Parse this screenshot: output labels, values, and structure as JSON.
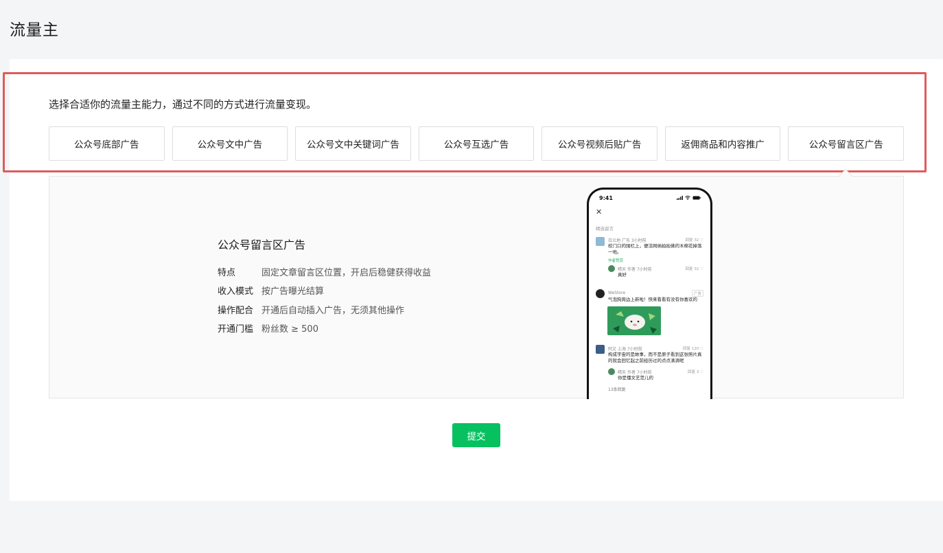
{
  "page": {
    "title": "流量主"
  },
  "intro": {
    "text": "选择合适你的流量主能力，通过不同的方式进行流量变现。"
  },
  "options": [
    {
      "label": "公众号底部广告"
    },
    {
      "label": "公众号文中广告"
    },
    {
      "label": "公众号文中关键词广告"
    },
    {
      "label": "公众号互选广告"
    },
    {
      "label": "公众号视频后贴广告"
    },
    {
      "label": "返佣商品和内容推广"
    },
    {
      "label": "公众号留言区广告"
    }
  ],
  "detail": {
    "title": "公众号留言区广告",
    "features": [
      {
        "key": "特点",
        "value": "固定文章留言区位置，开启后稳健获得收益"
      },
      {
        "key": "收入模式",
        "value": "按广告曝光结算"
      },
      {
        "key": "操作配合",
        "value": "开通后自动插入广告，无须其他操作"
      },
      {
        "key": "开通门槛",
        "value": "粉丝数 ≥ 500"
      }
    ]
  },
  "phone": {
    "time": "9:41",
    "close_icon": "close-icon",
    "section_label": "精选留言",
    "comments": [
      {
        "name": "白兰地",
        "meta": "广东 3小时前",
        "reply": "回复",
        "likes": "32",
        "text": "校门口的围栏上，便洁网纳拍拍佛的木棉花掉落一地。",
        "tag": "作者赞赏"
      },
      {
        "name": "晴天",
        "meta": "作者 7小时前",
        "reply": "回复",
        "likes": "32",
        "text": "真好"
      },
      {
        "name": "WeStore",
        "badge": "广告",
        "text": "气泡狗周边上新啦！快来看看有没有你喜欢的"
      },
      {
        "name": "阿文",
        "meta": "上海 7小时前",
        "reply": "回复",
        "likes": "120",
        "text": "构成宇宙的是故事，而不是原子看到这张照片真的就会回忆起之前经历过的点点滴滴呢"
      },
      {
        "name": "晴天",
        "meta": "作者 7小时前",
        "reply": "回复",
        "likes": "3",
        "text": "你是懂文艺范儿的"
      },
      {
        "text": "13条回复"
      }
    ]
  },
  "actions": {
    "submit_label": "提交"
  },
  "colors": {
    "accent": "#07c160",
    "highlight": "#e05a5a"
  }
}
